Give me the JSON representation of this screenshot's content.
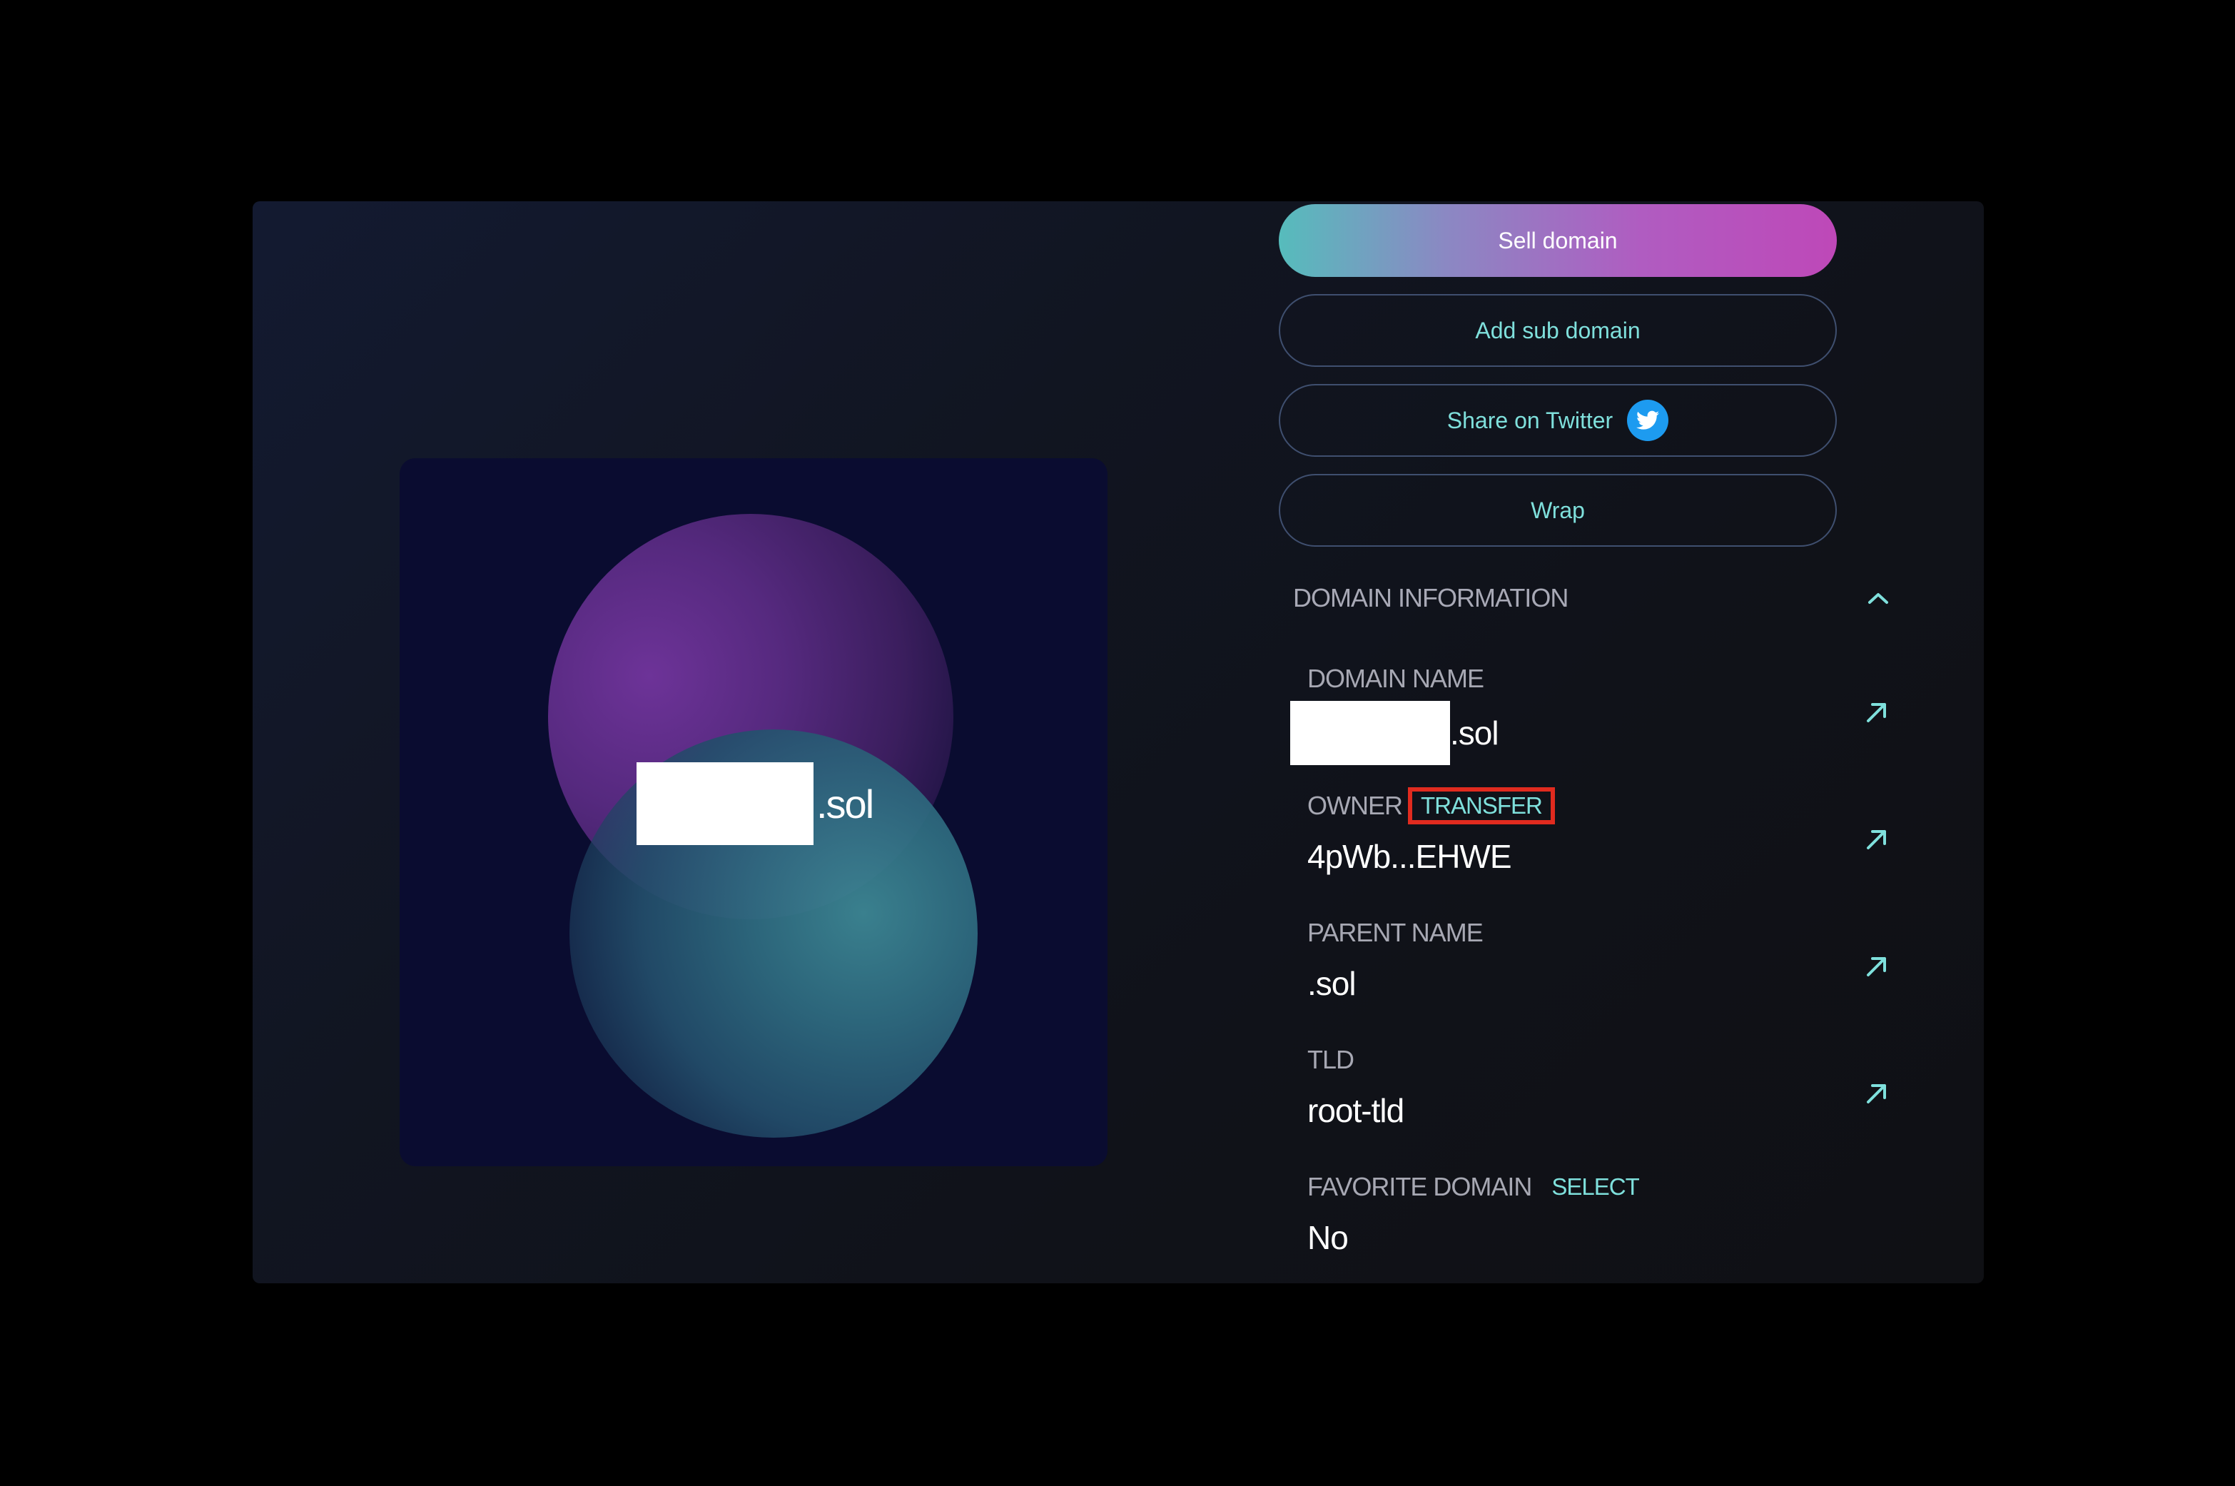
{
  "nft": {
    "suffix": ".sol"
  },
  "actions": {
    "sell_label": "Sell domain",
    "add_sub_label": "Add sub domain",
    "share_label": "Share on Twitter",
    "wrap_label": "Wrap"
  },
  "info": {
    "section_title": "DOMAIN INFORMATION",
    "domain_name_label": "DOMAIN NAME",
    "domain_name_suffix": ".sol",
    "owner_label": "OWNER",
    "owner_action": "TRANSFER",
    "owner_value": "4pWb...EHWE",
    "parent_label": "PARENT NAME",
    "parent_value": ".sol",
    "tld_label": "TLD",
    "tld_value": "root-tld",
    "favorite_label": "FAVORITE DOMAIN",
    "favorite_action": "SELECT",
    "favorite_value": "No"
  },
  "colors": {
    "accent": "#7fe0dc",
    "highlight": "#e12b1f",
    "twitter": "#1d9bf0"
  },
  "icons": [
    "twitter-icon",
    "chevron-up-icon",
    "external-link-icon"
  ]
}
